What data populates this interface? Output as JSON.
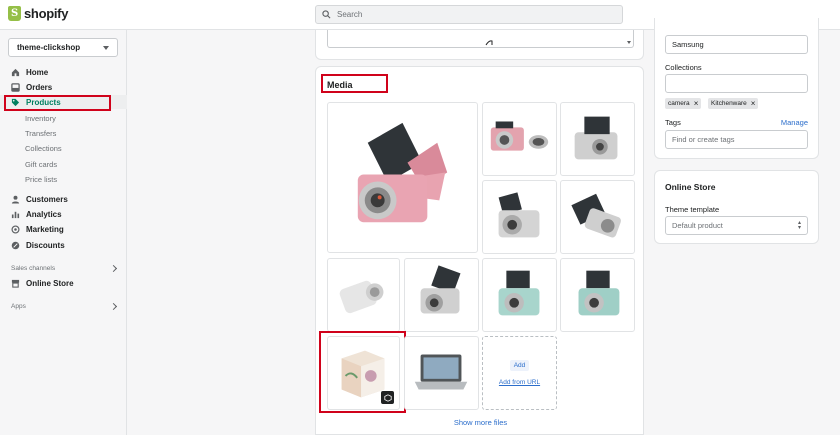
{
  "brand": {
    "name": "shopify"
  },
  "search": {
    "placeholder": "Search"
  },
  "sidebar": {
    "store": "theme-clickshop",
    "items": [
      {
        "label": "Home",
        "icon": "home-icon"
      },
      {
        "label": "Orders",
        "icon": "orders-icon"
      },
      {
        "label": "Products",
        "icon": "tag-icon"
      }
    ],
    "product_subitems": [
      "Inventory",
      "Transfers",
      "Collections",
      "Gift cards",
      "Price lists"
    ],
    "items2": [
      {
        "label": "Customers",
        "icon": "customers-icon"
      },
      {
        "label": "Analytics",
        "icon": "analytics-icon"
      },
      {
        "label": "Marketing",
        "icon": "marketing-icon"
      },
      {
        "label": "Discounts",
        "icon": "discounts-icon"
      }
    ],
    "sales_channels_label": "Sales channels",
    "online_store": "Online Store",
    "apps_label": "Apps"
  },
  "media": {
    "title": "Media",
    "add_label": "Add",
    "add_from_url": "Add from URL",
    "show_more": "Show more files"
  },
  "organization": {
    "vendor_value": "Samsung",
    "collections_label": "Collections",
    "collections": [
      "camera",
      "Kitchenware"
    ],
    "tags_label": "Tags",
    "manage": "Manage",
    "tags_placeholder": "Find or create tags"
  },
  "online_store_card": {
    "title": "Online Store",
    "theme_template_label": "Theme template",
    "theme_template_value": "Default product"
  },
  "colors": {
    "accent": "#008060",
    "link": "#2c6ecb",
    "highlight": "#d0021b"
  }
}
